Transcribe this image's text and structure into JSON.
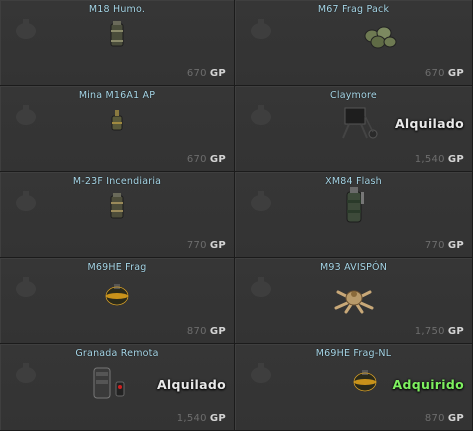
{
  "currency": "GP",
  "items": [
    {
      "name": "M18 Humo.",
      "price": "670",
      "status": "",
      "icon": "smoke-grenade-icon"
    },
    {
      "name": "M67 Frag Pack",
      "price": "670",
      "status": "",
      "icon": "frag-pack-icon"
    },
    {
      "name": "Mina M16A1 AP",
      "price": "670",
      "status": "",
      "icon": "mine-icon"
    },
    {
      "name": "Claymore",
      "price": "1,540",
      "status": "Alquilado",
      "icon": "claymore-icon"
    },
    {
      "name": "M-23F Incendiaria",
      "price": "770",
      "status": "",
      "icon": "incendiary-grenade-icon"
    },
    {
      "name": "XM84 Flash",
      "price": "770",
      "status": "",
      "icon": "flashbang-icon"
    },
    {
      "name": "M69HE Frag",
      "price": "870",
      "status": "",
      "icon": "frag-grenade-icon"
    },
    {
      "name": "M93 AVISPÓN",
      "price": "1,750",
      "status": "",
      "icon": "hornet-mine-icon"
    },
    {
      "name": "Granada Remota",
      "price": "1,540",
      "status": "Alquilado",
      "icon": "remote-grenade-icon"
    },
    {
      "name": "M69HE Frag-NL",
      "price": "870",
      "status": "Adquirido",
      "icon": "frag-grenade-icon"
    }
  ]
}
